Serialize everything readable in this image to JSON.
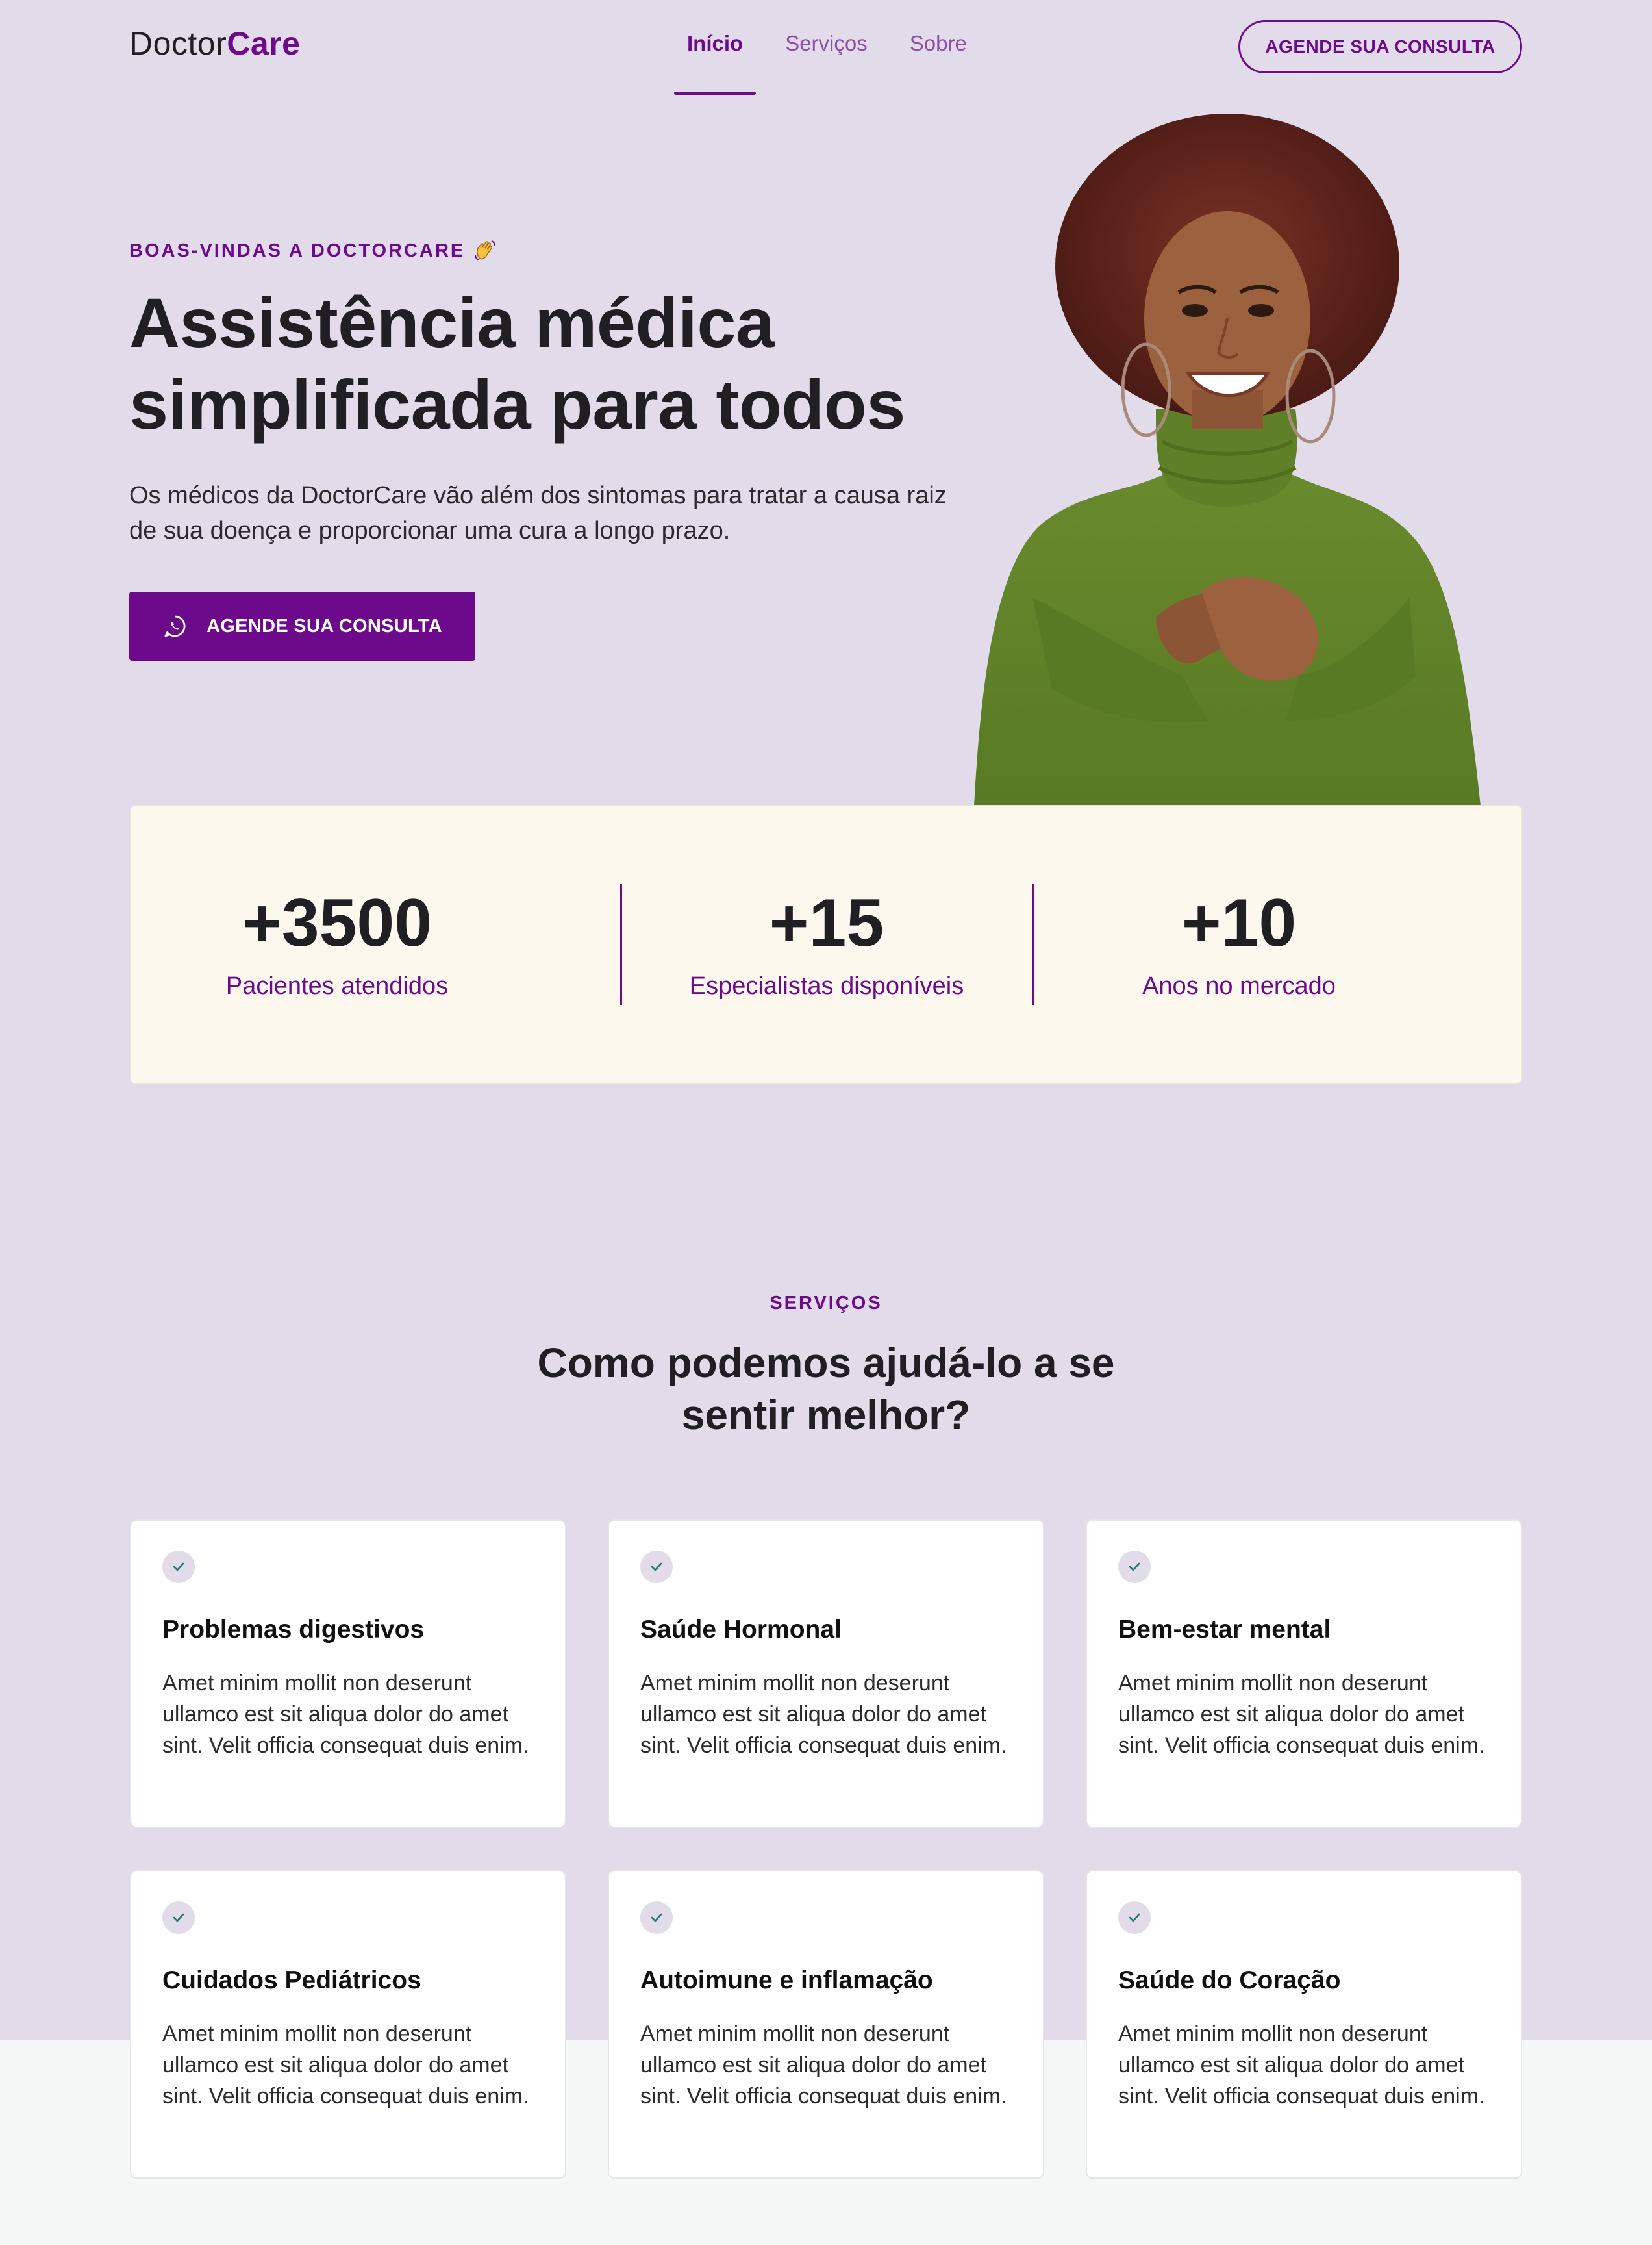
{
  "brand": {
    "name_prefix": "Doctor",
    "name_suffix": "Care"
  },
  "nav": {
    "items": [
      {
        "label": "Início",
        "active": true
      },
      {
        "label": "Serviços",
        "active": false
      },
      {
        "label": "Sobre",
        "active": false
      }
    ],
    "cta_label": "AGENDE SUA CONSULTA"
  },
  "hero": {
    "eyebrow": "BOAS-VINDAS A DOCTORCARE",
    "eyebrow_icon": "waving-hand-icon",
    "title": "Assistência médica simplificada para todos",
    "text": "Os médicos da DoctorCare vão além dos sintomas para tratar a causa raiz de sua doença e proporcionar uma cura a longo prazo.",
    "cta_label": "AGENDE SUA CONSULTA",
    "cta_icon": "whatsapp-icon"
  },
  "stats": [
    {
      "value": "+3500",
      "label": "Pacientes atendidos"
    },
    {
      "value": "+15",
      "label": "Especialistas disponíveis"
    },
    {
      "value": "+10",
      "label": "Anos no mercado"
    }
  ],
  "services": {
    "eyebrow": "SERVIÇOS",
    "title": "Como podemos ajudá-lo a se sentir melhor?",
    "cards": [
      {
        "title": "Problemas digestivos",
        "text": "Amet minim mollit non deserunt ullamco est sit aliqua dolor do amet sint. Velit officia consequat duis enim."
      },
      {
        "title": "Saúde Hormonal",
        "text": "Amet minim mollit non deserunt ullamco est sit aliqua dolor do amet sint. Velit officia consequat duis enim."
      },
      {
        "title": "Bem-estar mental",
        "text": "Amet minim mollit non deserunt ullamco est sit aliqua dolor do amet sint. Velit officia consequat duis enim."
      },
      {
        "title": "Cuidados Pediátricos",
        "text": "Amet minim mollit non deserunt ullamco est sit aliqua dolor do amet sint. Velit officia consequat duis enim."
      },
      {
        "title": "Autoimune e inflamação",
        "text": "Amet minim mollit non deserunt ullamco est sit aliqua dolor do amet sint. Velit officia consequat duis enim."
      },
      {
        "title": "Saúde do Coração",
        "text": "Amet minim mollit non deserunt ullamco est sit aliqua dolor do amet sint. Velit officia consequat duis enim."
      }
    ]
  },
  "colors": {
    "brand_purple": "#6d0a8c",
    "background_lilac": "#e2dcea",
    "stats_background": "#fdf8ed",
    "text_dark": "#202024",
    "check_green": "#1f7a6c"
  }
}
